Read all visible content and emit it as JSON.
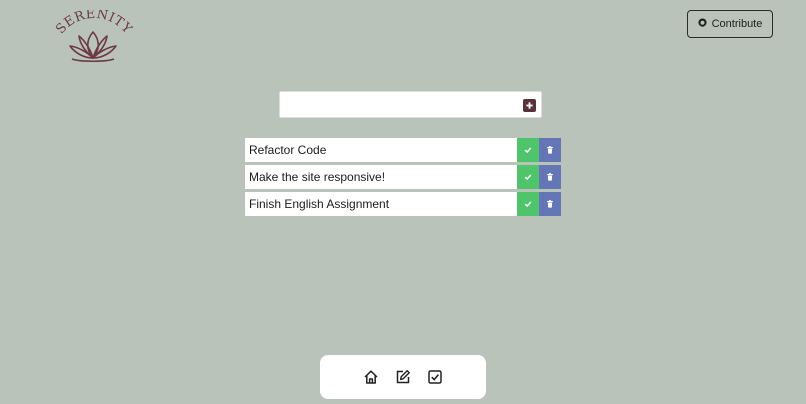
{
  "logo": {
    "text": "SERENITY"
  },
  "header": {
    "contribute_label": "Contribute"
  },
  "add_task": {
    "value": "",
    "placeholder": ""
  },
  "tasks": [
    {
      "text": "Refactor Code"
    },
    {
      "text": "Make the site responsive!"
    },
    {
      "text": "Finish English Assignment"
    }
  ],
  "icons": {
    "contribute": "github-icon",
    "add": "plus-square-icon",
    "done": "check-icon",
    "delete": "trash-icon",
    "nav": [
      "home-icon",
      "edit-icon",
      "checkbox-icon"
    ]
  },
  "colors": {
    "background": "#b9c3b9",
    "brand": "#6b3a45",
    "done": "#4fc46b",
    "delete": "#6476b6"
  }
}
